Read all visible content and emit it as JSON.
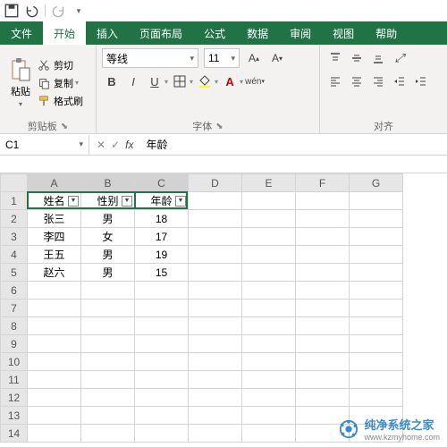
{
  "titlebar": {
    "qa": [
      "save",
      "undo",
      "redo"
    ]
  },
  "tabs": {
    "file": "文件",
    "items": [
      "开始",
      "插入",
      "页面布局",
      "公式",
      "数据",
      "审阅",
      "视图",
      "帮助"
    ],
    "active": 0
  },
  "ribbon": {
    "clipboard": {
      "paste": "粘贴",
      "cut": "剪切",
      "copy": "复制",
      "format_painter": "格式刷",
      "label": "剪贴板"
    },
    "font": {
      "name": "等线",
      "size": "11",
      "label": "字体"
    },
    "align": {
      "label": "对齐"
    }
  },
  "namebox": "C1",
  "formula": "年龄",
  "columns": [
    "A",
    "B",
    "C",
    "D",
    "E",
    "F",
    "G"
  ],
  "rows": [
    1,
    2,
    3,
    4,
    5,
    6,
    7,
    8,
    9,
    10,
    11,
    12,
    13,
    14
  ],
  "headers": [
    "姓名",
    "性别",
    "年龄"
  ],
  "data": [
    [
      "张三",
      "男",
      "18"
    ],
    [
      "李四",
      "女",
      "17"
    ],
    [
      "王五",
      "男",
      "19"
    ],
    [
      "赵六",
      "男",
      "15"
    ]
  ],
  "chart_data": {
    "type": "table",
    "columns": [
      "姓名",
      "性别",
      "年龄"
    ],
    "rows": [
      {
        "姓名": "张三",
        "性别": "男",
        "年龄": 18
      },
      {
        "姓名": "李四",
        "性别": "女",
        "年龄": 17
      },
      {
        "姓名": "王五",
        "性别": "男",
        "年龄": 19
      },
      {
        "姓名": "赵六",
        "性别": "男",
        "年龄": 15
      }
    ]
  },
  "watermark": {
    "text": "纯净系统之家",
    "url": "www.kzmyhome.com"
  }
}
